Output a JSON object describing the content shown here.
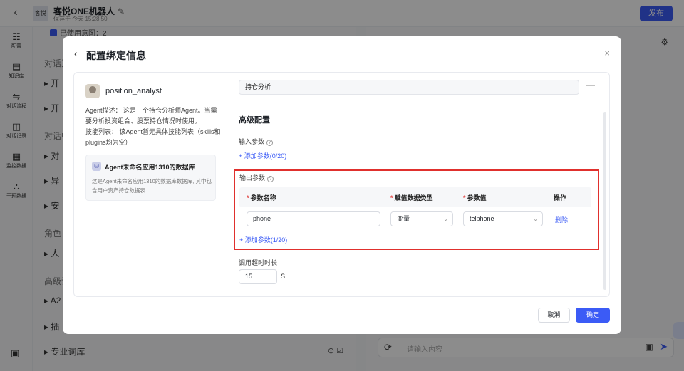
{
  "app": {
    "back_icon": "‹",
    "logo_text": "客悦",
    "title": "客悦ONE机器人",
    "edit_icon": "✎",
    "saved": "保存于 今天 15:28:50",
    "publish": "发布"
  },
  "sidenav": [
    {
      "icon": "☷",
      "label": "配置"
    },
    {
      "icon": "▤",
      "label": "知识库"
    },
    {
      "icon": "⇋",
      "label": "对话流程"
    },
    {
      "icon": "◫",
      "label": "对话记录"
    },
    {
      "icon": "▦",
      "label": "监控数据"
    },
    {
      "icon": "⛬",
      "label": "干预数据"
    }
  ],
  "sidenav_bottom_icon": "▣",
  "left_panel": {
    "used_intent": "已使用意图：2",
    "groups": [
      "对话开",
      "开",
      "开",
      "对话中",
      "对",
      "异",
      "安",
      "角色",
      "人",
      "高级设",
      "A2",
      "插",
      "专业词库"
    ],
    "row_icons": "⊙ ☑"
  },
  "right_panel": {
    "gear_icon": "⚙",
    "chat_clear_icon": "⟳",
    "chat_placeholder": "请输入内容",
    "chat_image_icon": "▣",
    "chat_send_icon": "➤"
  },
  "modal": {
    "back_icon": "‹",
    "title": "配置绑定信息",
    "close_icon": "×",
    "agent": {
      "name": "position_analyst",
      "desc_line1": "Agent描述：  这是一个持仓分析师Agent。当需要分析投资组合、股票持仓情况时使用。",
      "desc_line2": "技能列表：  该Agent暂无具体技能列表（skills和plugins均为空）",
      "db_title": "Agent未命名应用1310的数据库",
      "db_desc": "这是Agent未命名应用1310的数据库数据库, 其中包含用户资产持仓数据表"
    },
    "config": {
      "name_value": "持仓分析",
      "minus": "—",
      "section_title": "高级配置",
      "input_label": "输入参数",
      "add_input": "+ 添加参数(0/20)",
      "output_label": "输出参数",
      "headers": {
        "name": "参数名称",
        "type": "赋值数据类型",
        "value": "参数值",
        "action": "操作"
      },
      "required_mark": "*",
      "row": {
        "name": "phone",
        "type": "变量",
        "value": "telphone",
        "delete": "删除"
      },
      "chevron": "⌄",
      "add_output": "+ 添加参数(1/20)",
      "timeout_label": "调用超时时长",
      "timeout_value": "15",
      "timeout_unit": "S"
    },
    "cancel": "取消",
    "confirm": "确定"
  }
}
